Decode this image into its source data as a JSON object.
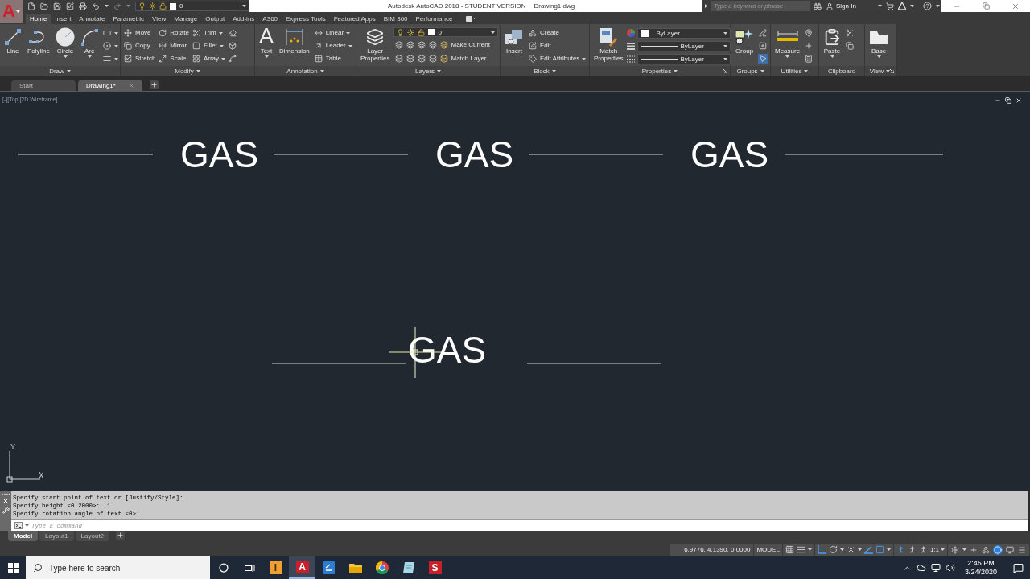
{
  "title_bar": {
    "app_button": "A",
    "layer_control": {
      "layer": "0"
    },
    "title": "Autodesk AutoCAD 2018 - STUDENT VERSION",
    "file_name": "Drawing1.dwg",
    "search": {
      "placeholder": "Type a keyword or phrase"
    },
    "sign_in": "Sign In"
  },
  "ribbon": {
    "tabs": [
      {
        "label": "Home",
        "selected": true
      },
      {
        "label": "Insert",
        "selected": false
      },
      {
        "label": "Annotate",
        "selected": false
      },
      {
        "label": "Parametric",
        "selected": false
      },
      {
        "label": "View",
        "selected": false
      },
      {
        "label": "Manage",
        "selected": false
      },
      {
        "label": "Output",
        "selected": false
      },
      {
        "label": "Add-ins",
        "selected": false
      },
      {
        "label": "A360",
        "selected": false
      },
      {
        "label": "Express Tools",
        "selected": false
      },
      {
        "label": "Featured Apps",
        "selected": false
      },
      {
        "label": "BIM 360",
        "selected": false
      },
      {
        "label": "Performance",
        "selected": false
      }
    ],
    "panels": [
      {
        "kind": "tools",
        "title": "Draw",
        "menu": true,
        "launcher": false,
        "large": [
          {
            "label": "Line",
            "dropdown": false
          },
          {
            "label": "Polyline",
            "dropdown": false
          },
          {
            "label": "Circle",
            "dropdown": true
          },
          {
            "label": "Arc",
            "dropdown": true
          }
        ],
        "columns": [
          [
            {
              "dropdown": true
            },
            {
              "dropdown": true
            },
            {
              "dropdown": true
            }
          ]
        ]
      },
      {
        "kind": "tools",
        "title": "Modify",
        "menu": true,
        "launcher": false,
        "columns": [
          [
            {
              "label": "Move",
              "dropdown": false
            },
            {
              "label": "Copy",
              "dropdown": false
            },
            {
              "label": "Stretch",
              "dropdown": false
            }
          ],
          [
            {
              "label": "Rotate",
              "dropdown": false
            },
            {
              "label": "Mirror",
              "dropdown": false
            },
            {
              "label": "Scale",
              "dropdown": false
            }
          ],
          [
            {
              "label": "Trim",
              "dropdown": true
            },
            {
              "label": "Fillet",
              "dropdown": true
            },
            {
              "label": "Array",
              "dropdown": true
            }
          ],
          [
            {
              "dropdown": false
            },
            {
              "dropdown": false
            },
            {
              "dropdown": false
            }
          ]
        ]
      },
      {
        "kind": "tools",
        "title": "Annotation",
        "menu": true,
        "launcher": false,
        "large": [
          {
            "label": "Text",
            "glyph": "A",
            "dropdown": true
          },
          {
            "label": "Dimension",
            "dropdown": false
          }
        ],
        "columns": [
          [
            {
              "label": "Linear",
              "dropdown": true
            },
            {
              "label": "Leader",
              "dropdown": true
            },
            {
              "label": "Table",
              "dropdown": false
            }
          ]
        ]
      },
      {
        "kind": "layers",
        "title": "Layers",
        "menu": true,
        "launcher": false,
        "large": [
          {
            "label": "Layer Properties",
            "dropdown": false
          }
        ],
        "layer": "0",
        "rows": [
          {
            "label": "Make Current"
          },
          {
            "label": "Match Layer"
          }
        ]
      },
      {
        "kind": "tools",
        "title": "Block",
        "menu": true,
        "launcher": false,
        "large": [
          {
            "label": "Insert",
            "dropdown": false
          }
        ],
        "columns": [
          [
            {
              "label": "Create",
              "dropdown": false
            },
            {
              "label": "Edit",
              "dropdown": false
            },
            {
              "label": "Edit Attributes",
              "dropdown": true
            }
          ]
        ]
      },
      {
        "kind": "properties",
        "title": "Properties",
        "menu": true,
        "launcher": true,
        "large": [
          {
            "label": "Match Properties",
            "dropdown": false
          }
        ],
        "fields": [
          {
            "kind": "color",
            "value": "ByLayer"
          },
          {
            "kind": "linetype",
            "value": "ByLayer"
          },
          {
            "kind": "lineweight",
            "value": "ByLayer"
          }
        ]
      },
      {
        "kind": "tools",
        "title": "Groups",
        "menu": true,
        "launcher": false,
        "large": [
          {
            "label": "Group",
            "dropdown": false
          }
        ],
        "columns": [
          [
            {
              "dropdown": false,
              "on": false
            },
            {
              "dropdown": false,
              "on": false
            },
            {
              "dropdown": false,
              "on": true
            }
          ]
        ]
      },
      {
        "kind": "tools",
        "title": "Utilities",
        "menu": true,
        "launcher": false,
        "large": [
          {
            "label": "Measure",
            "dropdown": true
          }
        ],
        "columns": [
          [
            {
              "dropdown": false
            },
            {
              "dropdown": false
            },
            {
              "dropdown": false
            }
          ]
        ]
      },
      {
        "kind": "tools",
        "title": "Clipboard",
        "menu": false,
        "launcher": false,
        "large": [
          {
            "label": "Paste",
            "dropdown": true
          }
        ],
        "columns": [
          [
            {
              "dropdown": false
            },
            {
              "dropdown": false
            }
          ]
        ]
      },
      {
        "kind": "tools",
        "title": "View",
        "menu": true,
        "launcher": true,
        "large": [
          {
            "label": "Base",
            "dropdown": true
          }
        ]
      }
    ]
  },
  "file_tabs": [
    {
      "label": "Start",
      "selected": false,
      "closable": false
    },
    {
      "label": "Drawing1*",
      "selected": true,
      "closable": true
    }
  ],
  "viewport": {
    "label": "[-][Top][2D Wireframe]",
    "texts": [
      "GAS",
      "GAS",
      "GAS",
      "GAS"
    ],
    "ucs": {
      "x": "X",
      "y": "Y"
    }
  },
  "command_line": {
    "history": [
      "Specify start point of text or [Justify/Style]:",
      "Specify height <0.2000>: .1",
      "Specify rotation angle of text <0>:"
    ],
    "placeholder": "Type a command"
  },
  "layout_tabs": [
    {
      "label": "Model",
      "selected": true
    },
    {
      "label": "Layout1",
      "selected": false
    },
    {
      "label": "Layout2",
      "selected": false
    }
  ],
  "status_bar": {
    "coordinates": "6.9776, 4.1390, 0.0000",
    "space": "MODEL",
    "toggles": [
      {
        "on": false,
        "dropdown": false
      },
      {
        "on": false,
        "dropdown": true
      },
      {
        "on": true,
        "dropdown": false
      },
      {
        "on": false,
        "dropdown": true
      },
      {
        "on": false,
        "dropdown": true
      },
      {
        "on": true,
        "dropdown": false
      },
      {
        "on": true,
        "dropdown": true
      },
      {
        "on": true,
        "dropdown": false
      },
      {
        "on": false,
        "dropdown": false
      },
      {
        "on": false,
        "dropdown": false
      }
    ],
    "scale": "1:1",
    "tools": [
      {
        "on": false,
        "dropdown": true
      },
      {
        "on": false,
        "dropdown": false
      },
      {
        "on": false,
        "dropdown": false
      },
      {
        "on": true,
        "dropdown": false
      },
      {
        "on": false,
        "dropdown": false
      },
      {
        "on": false,
        "dropdown": false
      }
    ]
  },
  "taskbar": {
    "search": {
      "placeholder": "Type here to search"
    },
    "apps": [
      {
        "glyph": "I",
        "selected": false
      },
      {
        "glyph": "A",
        "selected": true
      },
      {
        "selected": false
      },
      {
        "selected": false
      },
      {
        "selected": false
      },
      {
        "selected": false
      },
      {
        "glyph": "S",
        "selected": false
      }
    ],
    "time": "2:45 PM",
    "date": "3/24/2020"
  }
}
